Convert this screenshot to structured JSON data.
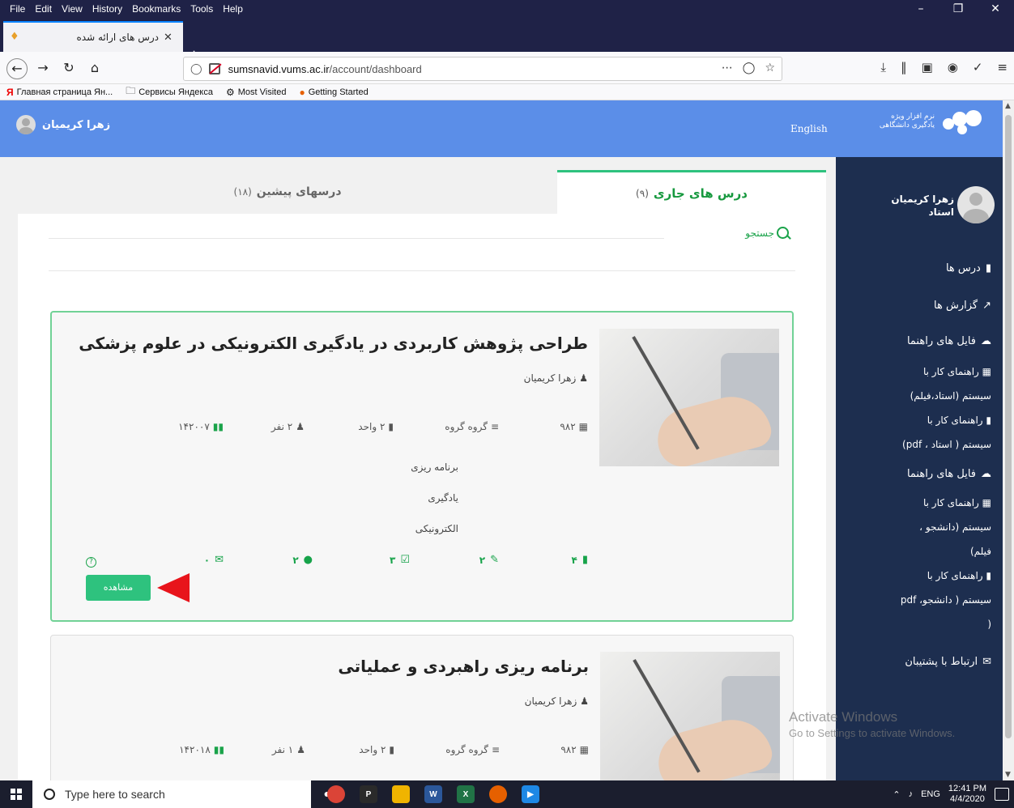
{
  "browser": {
    "menu": [
      "File",
      "Edit",
      "View",
      "History",
      "Bookmarks",
      "Tools",
      "Help"
    ],
    "tab_title": "درس های ارائه شده",
    "url_domain": "sumsnavid.vums.ac.ir",
    "url_path": "/account/dashboard",
    "bookmarks": [
      "Главная страница Ян...",
      "Сервисы Яндекса",
      "Most Visited",
      "Getting Started"
    ]
  },
  "header": {
    "user_name": "زهرا کریمیان",
    "lang_link": "English",
    "logo_line1": "نرم افزار ویژه",
    "logo_line2": "یادگیری دانشگاهی"
  },
  "sidebar": {
    "profile_name": "زهرا کریمیان",
    "profile_role": "استاد",
    "items": [
      {
        "label": "درس ها",
        "icon": "book-icon"
      },
      {
        "label": "گزارش ها",
        "icon": "chart-icon"
      },
      {
        "label": "فایل های راهنما",
        "icon": "cloud-download-icon"
      }
    ],
    "guide_teacher": [
      "راهنمای کار با",
      "سیستم (استاد،فیلم)",
      "راهنمای کار با",
      "سیستم ( استاد ، pdf)"
    ],
    "guides2_label": "فایل های راهنما",
    "guide_student": [
      "راهنمای کار با",
      "سیستم (دانشجو ،",
      "فیلم)",
      "راهنمای کار با",
      "سیستم ( دانشجو، pdf",
      "("
    ],
    "support": "ارتباط با پشتیبان"
  },
  "tabs": {
    "current_label": "درس های جاری",
    "current_count": "(۹)",
    "past_label": "درسهای پیشین",
    "past_count": "(۱۸)"
  },
  "search": {
    "label": "جستجو"
  },
  "courses": [
    {
      "title": "طراحی پژوهش کاربردی در یادگیری الکترونیکی در علوم پزشکی",
      "author": "زهرا کریمیان",
      "term": "۹۸۲",
      "group": "گروه گروه",
      "units": "۲  واحد",
      "people": "۲ نفر",
      "code": "۱۴۲۰۰۷",
      "group_words": [
        "برنامه ریزی",
        "یادگیری",
        "الکترونیکی"
      ],
      "stats": [
        "۴",
        "۲",
        "۳",
        "۲",
        "۰"
      ],
      "view_label": "مشاهده"
    },
    {
      "title": "برنامه ریزی راهبردی و عملیاتی",
      "author": "زهرا کریمیان",
      "term": "۹۸۲",
      "group": "گروه گروه",
      "units": "۲  واحد",
      "people": "۱ نفر",
      "code": "۱۴۲۰۱۸"
    }
  ],
  "watermark": {
    "line1": "Activate Windows",
    "line2": "Go to Settings to activate Windows."
  },
  "taskbar": {
    "search_placeholder": "Type here to search",
    "lang": "ENG",
    "time": "12:41 PM",
    "date": "4/4/2020"
  },
  "colors": {
    "header_blue": "#5b8ee8",
    "sidebar_navy": "#1d2e4f",
    "accent_green": "#2ec27e",
    "arrow_red": "#e8141b"
  }
}
